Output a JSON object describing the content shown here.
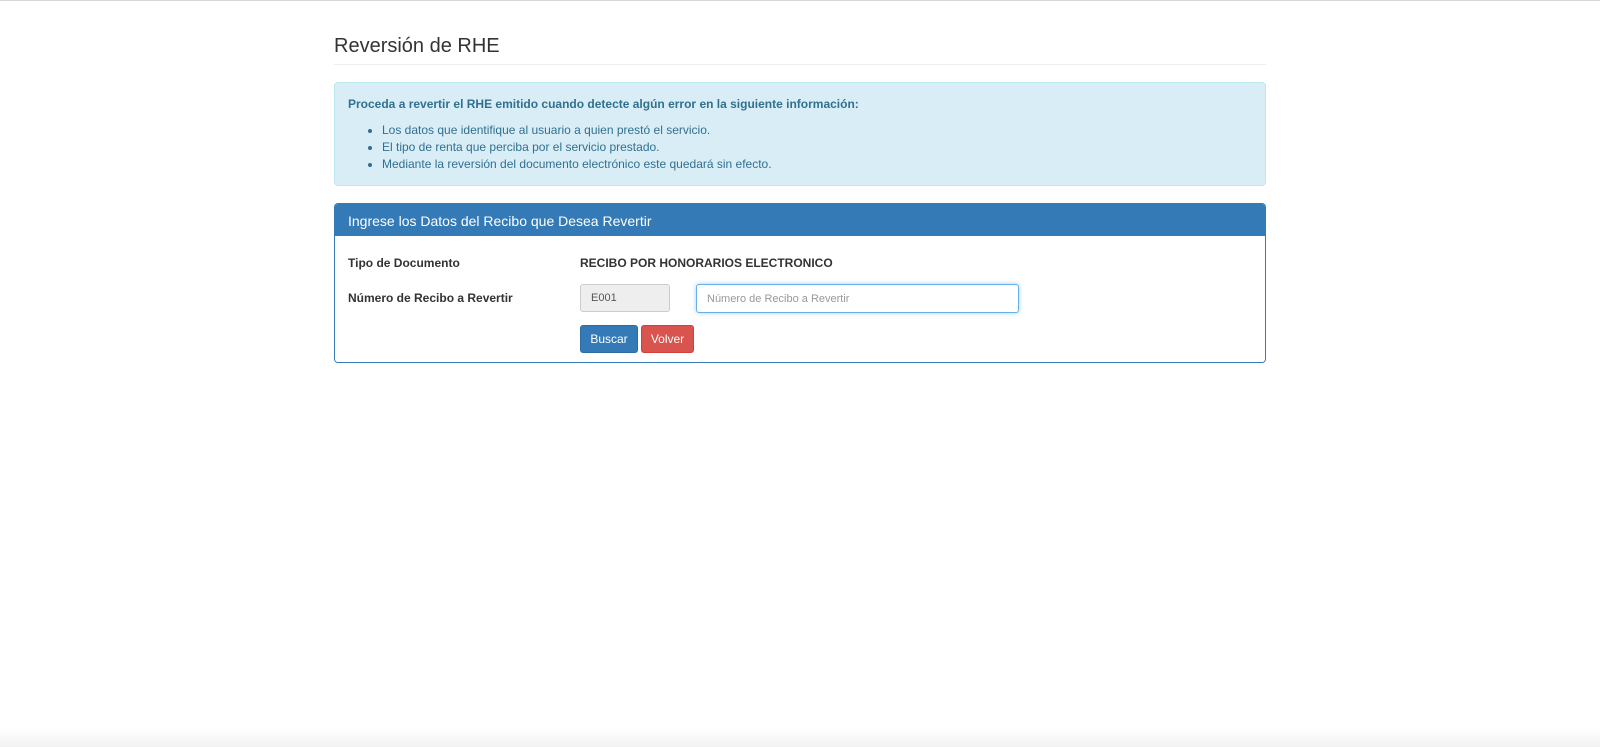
{
  "page": {
    "title": "Reversión de RHE"
  },
  "alert": {
    "intro": "Proceda a revertir el RHE emitido cuando detecte algún error en la siguiente información:",
    "items": [
      "Los datos que identifique al usuario a quien prestó el servicio.",
      "El tipo de renta que perciba por el servicio prestado.",
      "Mediante la reversión del documento electrónico este quedará sin efecto."
    ]
  },
  "panel": {
    "heading": "Ingrese los Datos del Recibo que Desea Revertir",
    "doc_type_label": "Tipo de Documento",
    "doc_type_value": "RECIBO POR HONORARIOS ELECTRONICO",
    "receipt_label": "Número de Recibo a Revertir",
    "series_value": "E001",
    "receipt_input": {
      "value": "",
      "placeholder": "Número de Recibo a Revertir"
    },
    "search_button": "Buscar",
    "back_button": "Volver"
  },
  "colors": {
    "primary": "#337ab7",
    "danger": "#d9534f",
    "info_bg": "#d9edf7",
    "info_text": "#31708f"
  }
}
